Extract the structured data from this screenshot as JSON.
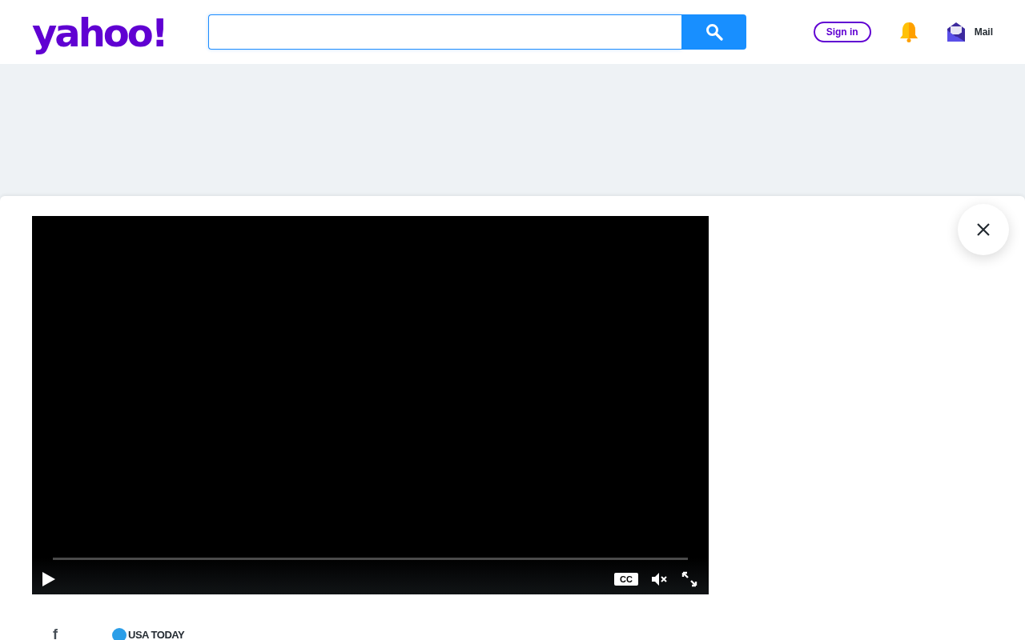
{
  "header": {
    "logo": "yahoo!",
    "sign_in": "Sign in",
    "mail_label": "Mail"
  },
  "video": {
    "progress": {
      "level": 0
    },
    "captions_label": "CC",
    "muted": true
  },
  "footer": {
    "share_label": "f",
    "publisher": "USA TODAY"
  }
}
